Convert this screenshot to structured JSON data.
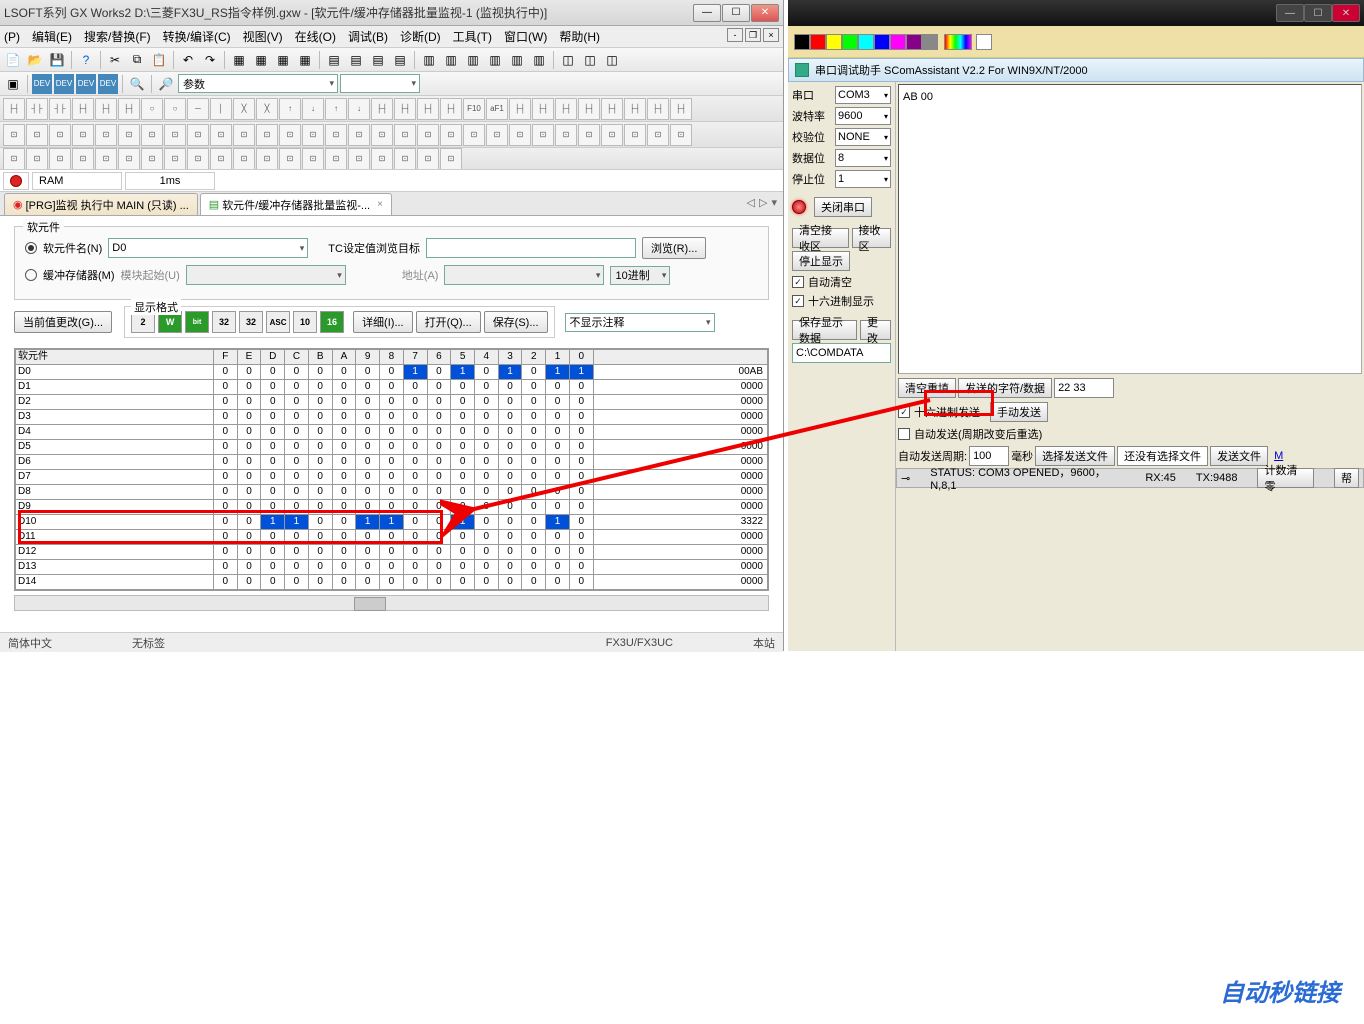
{
  "left": {
    "title": "LSOFT系列 GX Works2 D:\\三菱FX3U_RS指令样例.gxw - [软元件/缓冲存储器批量监视-1 (监视执行中)]",
    "menus": [
      "(P)",
      "编辑(E)",
      "搜索/替换(F)",
      "转换/编译(C)",
      "视图(V)",
      "在线(O)",
      "调试(B)",
      "诊断(D)",
      "工具(T)",
      "窗口(W)",
      "帮助(H)"
    ],
    "param_combo": "参数",
    "status": {
      "ram": "RAM",
      "time": "1ms"
    },
    "tabs": [
      {
        "label": "[PRG]监视 执行中 MAIN (只读) ...",
        "active": false
      },
      {
        "label": "软元件/缓冲存储器批量监视-...",
        "active": true
      }
    ],
    "panel": {
      "group_label": "软元件",
      "radio_dev": "软元件名(N)",
      "radio_buf": "缓冲存储器(M)",
      "dev_value": "D0",
      "tc_label": "TC设定值浏览目标",
      "browse": "浏览(R)...",
      "module_label": "模块起始(U)",
      "addr_label": "地址(A)",
      "radix": "10进制",
      "fmt_label": "显示格式",
      "cur_modify": "当前值更改(G)...",
      "fmt_2": "2",
      "fmt_w": "W",
      "fmt_bit": "bit",
      "fmt_32": "32",
      "fmt_32b": "32",
      "fmt_asc": "ASC",
      "fmt_10": "10",
      "fmt_16": "16",
      "detail": "详细(I)...",
      "open": "打开(Q)...",
      "save": "保存(S)...",
      "comment": "不显示注释"
    },
    "table": {
      "header": "软元件",
      "bits": [
        "F",
        "E",
        "D",
        "C",
        "B",
        "A",
        "9",
        "8",
        "7",
        "6",
        "5",
        "4",
        "3",
        "2",
        "1",
        "0"
      ],
      "rows": [
        {
          "name": "D0",
          "b": "0000000010101011",
          "val": "00AB"
        },
        {
          "name": "D1",
          "b": "0000000000000000",
          "val": "0000"
        },
        {
          "name": "D2",
          "b": "0000000000000000",
          "val": "0000"
        },
        {
          "name": "D3",
          "b": "0000000000000000",
          "val": "0000"
        },
        {
          "name": "D4",
          "b": "0000000000000000",
          "val": "0000"
        },
        {
          "name": "D5",
          "b": "0000000000000000",
          "val": "0000"
        },
        {
          "name": "D6",
          "b": "0000000000000000",
          "val": "0000"
        },
        {
          "name": "D7",
          "b": "0000000000000000",
          "val": "0000"
        },
        {
          "name": "D8",
          "b": "0000000000000000",
          "val": "0000"
        },
        {
          "name": "D9",
          "b": "0000000000000000",
          "val": "0000"
        },
        {
          "name": "D10",
          "b": "0011001100100010",
          "val": "3322"
        },
        {
          "name": "D11",
          "b": "0000000000000000",
          "val": "0000"
        },
        {
          "name": "D12",
          "b": "0000000000000000",
          "val": "0000"
        },
        {
          "name": "D13",
          "b": "0000000000000000",
          "val": "0000"
        },
        {
          "name": "D14",
          "b": "0000000000000000",
          "val": "0000"
        }
      ]
    },
    "footer": {
      "lang": "简体中文",
      "tag": "无标签",
      "model": "FX3U/FX3UC",
      "host": "本站"
    }
  },
  "right": {
    "app_title": "串口调试助手 SComAssistant V2.2 For WIN9X/NT/2000",
    "labels": {
      "port": "串口",
      "baud": "波特率",
      "parity": "校验位",
      "data": "数据位",
      "stop": "停止位"
    },
    "vals": {
      "port": "COM3",
      "baud": "9600",
      "parity": "NONE",
      "data": "8",
      "stop": "1"
    },
    "close_port": "关闭串口",
    "clear_rx": "清空接收区",
    "rx_area": "接收区",
    "stop_disp": "停止显示",
    "auto_clear": "自动清空",
    "hex_disp": "十六进制显示",
    "save_data": "保存显示数据",
    "modify": "更改",
    "path": "C:\\COMDATA",
    "rx_content": "AB 00",
    "clear_fill": "清空重填",
    "send_label": "发送的字符/数据",
    "tx_content": "22 33",
    "hex_send": "十六进制发送",
    "manual_send": "手动发送",
    "auto_send": "自动发送(周期改变后重选)",
    "auto_period_lbl": "自动发送周期:",
    "auto_period": "100",
    "ms": "毫秒",
    "sel_file": "选择发送文件",
    "no_file": "还没有选择文件",
    "send_file": "发送文件",
    "mail": "M",
    "status": {
      "text": "STATUS: COM3 OPENED，9600，N,8,1",
      "rx": "RX:45",
      "tx": "TX:9488",
      "clear": "计数清零",
      "help": "帮"
    }
  },
  "watermark": "自动秒链接"
}
